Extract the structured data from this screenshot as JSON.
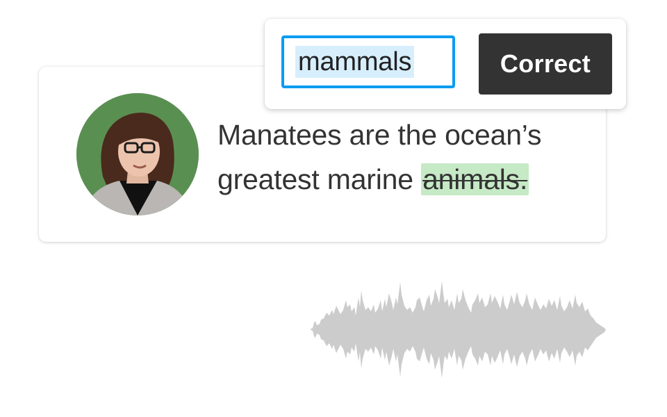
{
  "transcript": {
    "line1": "Manatees are the ocean’s",
    "line2_prefix": "greatest marine ",
    "flagged_word": "animals."
  },
  "correction": {
    "input_value": "mammals",
    "button_label": "Correct"
  },
  "colors": {
    "accent_blue": "#0a9cf2",
    "selection_bg": "#d7eefd",
    "flag_highlight": "#c6e9c6",
    "button_bg": "#333333",
    "waveform": "#cccccc",
    "avatar_bg": "#5a8f52"
  },
  "icons": {
    "avatar": "speaker-avatar",
    "waveform": "audio-waveform"
  }
}
